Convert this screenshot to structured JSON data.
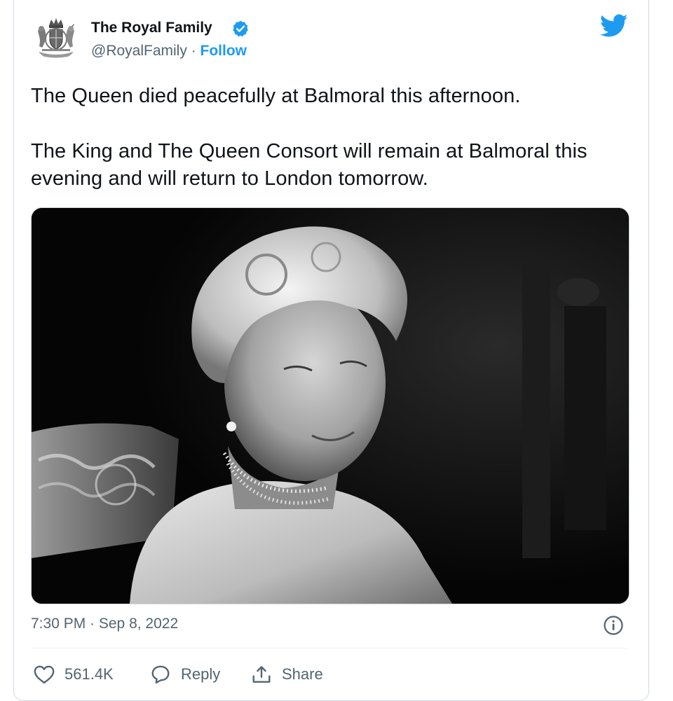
{
  "author": {
    "display_name": "The Royal Family",
    "handle": "@RoyalFamily",
    "separator": "·",
    "follow_label": "Follow",
    "avatar_icon": "royal-coat-of-arms-icon",
    "verified_icon": "verified-badge-icon"
  },
  "platform_icon": "twitter-bird-icon",
  "tweet": {
    "paragraphs": [
      "The Queen died peacefully at Balmoral this afternoon.",
      "The King and The Queen Consort will remain at Balmoral this evening and will return to London tomorrow."
    ],
    "media_icon": "black-and-white-portrait-photo",
    "timestamp": "7:30 PM · Sep 8, 2022",
    "info_icon": "info-icon"
  },
  "actions": {
    "like": {
      "icon": "heart-icon",
      "count": "561.4K"
    },
    "reply": {
      "icon": "reply-bubble-icon",
      "label": "Reply"
    },
    "share": {
      "icon": "share-icon",
      "label": "Share"
    }
  },
  "colors": {
    "accent": "#1d9bf0",
    "text_primary": "#0f1419",
    "text_secondary": "#536471",
    "border": "#cfd9de"
  }
}
